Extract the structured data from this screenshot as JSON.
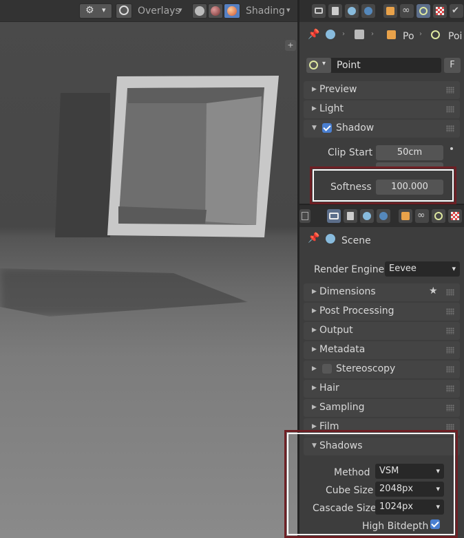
{
  "viewport": {
    "overlays_label": "Overlays",
    "shading_label": "Shading",
    "colors": {
      "frame": "#c4c4c4",
      "interior": "#7a7a7a",
      "floor": "#808080"
    }
  },
  "light_editor": {
    "breadcrumb": [
      "Po",
      "Poi"
    ],
    "object_name": "Point",
    "fake_user_label": "F",
    "panels": {
      "preview": "Preview",
      "light": "Light",
      "shadow": "Shadow"
    },
    "shadow_checked": true,
    "clip_start_label": "Clip Start",
    "clip_start_value": "50cm",
    "softness_label": "Softness",
    "softness_value": "100.000"
  },
  "render_editor": {
    "context_label": "Scene",
    "render_engine_label": "Render Engine",
    "render_engine_value": "Eevee",
    "panels": [
      "Dimensions",
      "Post Processing",
      "Output",
      "Metadata",
      "Stereoscopy",
      "Hair",
      "Sampling",
      "Film"
    ],
    "shadows_panel": "Shadows",
    "method_label": "Method",
    "method_value": "VSM",
    "cube_size_label": "Cube Size",
    "cube_size_value": "2048px",
    "cascade_size_label": "Cascade Size",
    "cascade_size_value": "1024px",
    "high_bitdepth_label": "High Bitdepth",
    "high_bitdepth_checked": true
  },
  "highlight_color": "#6e1f24"
}
